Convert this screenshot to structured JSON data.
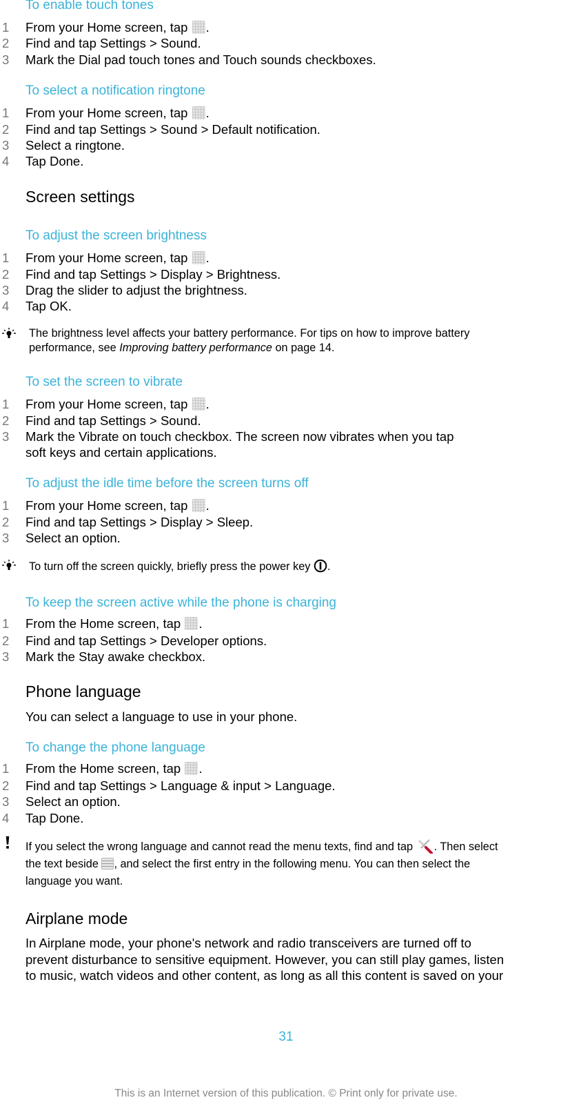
{
  "sections": {
    "touch_tones": {
      "title": "To enable touch tones",
      "steps": [
        {
          "num": "1",
          "pre": "From your Home screen, tap ",
          "icon": "apps-grid-icon",
          "post": "."
        },
        {
          "num": "2",
          "a": "Find and tap ",
          "b1": "Settings",
          "s1": " > ",
          "b2": "Sound",
          "end": "."
        },
        {
          "num": "3",
          "a": "Mark the ",
          "b1": "Dial pad touch tones",
          "s1": " and ",
          "b2": "Touch sounds",
          "end": " checkboxes."
        }
      ]
    },
    "notification_ringtone": {
      "title": "To select a notification ringtone",
      "steps": [
        {
          "num": "1",
          "pre": "From your Home screen, tap ",
          "icon": "apps-grid-icon",
          "post": "."
        },
        {
          "num": "2",
          "a": "Find and tap ",
          "b1": "Settings",
          "s1": " > ",
          "b2": "Sound",
          "s2": " > ",
          "b3": "Default notification",
          "end": "."
        },
        {
          "num": "3",
          "text": "Select a ringtone."
        },
        {
          "num": "4",
          "a": "Tap ",
          "b1": "Done",
          "end": "."
        }
      ]
    },
    "screen_settings": {
      "heading": "Screen settings"
    },
    "brightness": {
      "title": "To adjust the screen brightness",
      "steps": [
        {
          "num": "1",
          "pre": "From your Home screen, tap ",
          "icon": "apps-grid-icon",
          "post": "."
        },
        {
          "num": "2",
          "a": "Find and tap ",
          "b1": "Settings",
          "s1": " > ",
          "b2": "Display",
          "s2": " > ",
          "b3": "Brightness",
          "end": "."
        },
        {
          "num": "3",
          "text": "Drag the slider to adjust the brightness."
        },
        {
          "num": "4",
          "a": "Tap ",
          "b1": "OK",
          "end": "."
        }
      ],
      "tip": {
        "icon": "lightbulb-icon",
        "line1": "The brightness level affects your battery performance. For tips on how to improve battery",
        "line2_pre": "performance, see ",
        "line2_link": "Improving battery performance",
        "line2_post": " on page 14."
      }
    },
    "vibrate": {
      "title": "To set the screen to vibrate",
      "steps": [
        {
          "num": "1",
          "pre": "From your Home screen, tap ",
          "icon": "apps-grid-icon",
          "post": "."
        },
        {
          "num": "2",
          "a": "Find and tap ",
          "b1": "Settings",
          "s1": " > ",
          "b2": "Sound",
          "end": "."
        },
        {
          "num": "3",
          "a": "Mark the ",
          "b1": "Vibrate on touch",
          "end": " checkbox. The screen now vibrates when you tap",
          "line2": "soft keys and certain applications."
        }
      ]
    },
    "idle_time": {
      "title": "To adjust the idle time before the screen turns off",
      "steps": [
        {
          "num": "1",
          "pre": "From your Home screen, tap ",
          "icon": "apps-grid-icon",
          "post": "."
        },
        {
          "num": "2",
          "a": "Find and tap ",
          "b1": "Settings",
          "s1": " > ",
          "b2": "Display",
          "s2": " > ",
          "b3": "Sleep",
          "end": "."
        },
        {
          "num": "3",
          "text": "Select an option."
        }
      ],
      "tip": {
        "icon": "lightbulb-icon",
        "pre": "To turn off the screen quickly, briefly press the power key ",
        "post": "."
      }
    },
    "stay_awake": {
      "title": "To keep the screen active while the phone is charging",
      "steps": [
        {
          "num": "1",
          "pre": "From the Home screen, tap ",
          "icon": "apps-grid-icon",
          "post": "."
        },
        {
          "num": "2",
          "a": "Find and tap ",
          "b1": "Settings",
          "s1": " > ",
          "b2": "Developer options",
          "end": "."
        },
        {
          "num": "3",
          "a": "Mark the ",
          "b1": "Stay awake",
          "end": " checkbox."
        }
      ]
    },
    "phone_language": {
      "heading": "Phone language",
      "intro": "You can select a language to use in your phone."
    },
    "change_language": {
      "title": "To change the phone language",
      "steps": [
        {
          "num": "1",
          "pre": "From the Home screen, tap ",
          "icon": "apps-grid-icon",
          "post": "."
        },
        {
          "num": "2",
          "a": "Find and tap ",
          "b1": "Settings",
          "s1": " > ",
          "b2": "Language & input",
          "s2": " > ",
          "b3": "Language",
          "end": "."
        },
        {
          "num": "3",
          "text": "Select an option."
        },
        {
          "num": "4",
          "a": "Tap ",
          "b1": "Done",
          "end": "."
        }
      ],
      "warning": {
        "icon": "exclamation-icon",
        "line1_pre": "If you select the wrong language and cannot read the menu texts, find and tap ",
        "line1_post": ". Then select",
        "line2_pre": "the text beside ",
        "line2_post": ", and select the first entry in the following menu. You can then select the",
        "line3": "language you want."
      }
    },
    "airplane_mode": {
      "heading": "Airplane mode",
      "lines": [
        "In Airplane mode, your phone's network and radio transceivers are turned off to",
        "prevent disturbance to sensitive equipment. However, you can still play games, listen",
        "to music, watch videos and other content, as long as all this content is saved on your"
      ]
    }
  },
  "page_number": "31",
  "footer": "This is an Internet version of this publication. © Print only for private use.",
  "colors": {
    "accent": "#3bb3d9",
    "step_number": "#777777",
    "footer": "#888888"
  }
}
